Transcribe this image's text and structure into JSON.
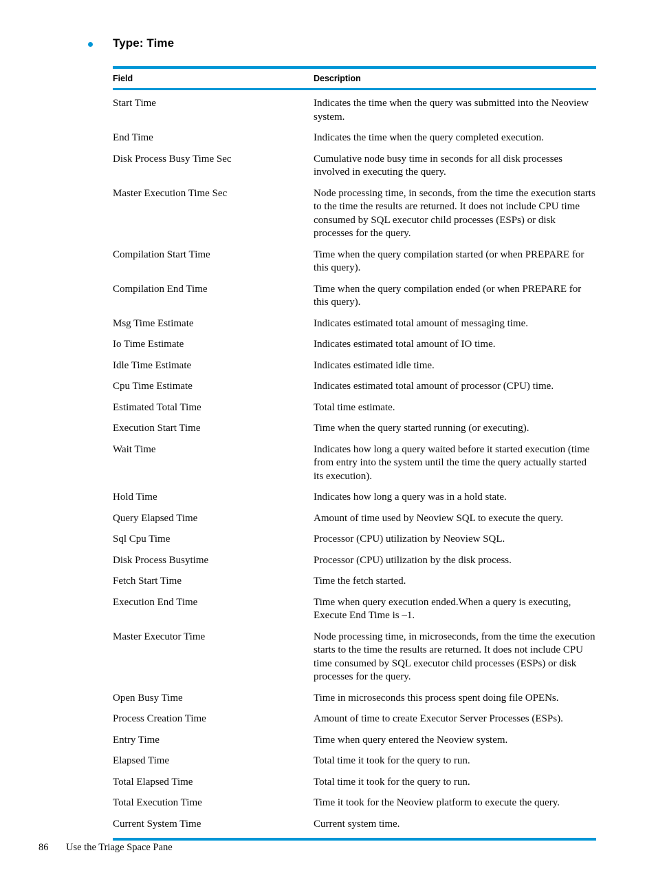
{
  "heading": {
    "bullet_color": "#0096d6",
    "text": "Type: Time"
  },
  "table": {
    "rule_color": "#0096d6",
    "columns": [
      "Field",
      "Description"
    ],
    "rows": [
      {
        "field": "Start Time",
        "description": "Indicates the time when the query was submitted into the Neoview system."
      },
      {
        "field": "End Time",
        "description": "Indicates the time when the query completed execution."
      },
      {
        "field": "Disk Process Busy Time Sec",
        "description": "Cumulative node busy time in seconds for all disk processes involved in executing the query."
      },
      {
        "field": "Master Execution Time Sec",
        "description": "Node processing time, in seconds, from the time the execution starts to the time the results are returned. It does not include CPU time consumed by SQL executor child processes (ESPs) or disk processes for the query."
      },
      {
        "field": "Compilation Start Time",
        "description": "Time when the query compilation started (or when PREPARE for this query)."
      },
      {
        "field": "Compilation End Time",
        "description": "Time when the query compilation ended (or when PREPARE for this query)."
      },
      {
        "field": "Msg Time Estimate",
        "description": "Indicates estimated total amount of messaging time."
      },
      {
        "field": "Io Time Estimate",
        "description": "Indicates estimated total amount of IO time."
      },
      {
        "field": "Idle Time Estimate",
        "description": "Indicates estimated idle time."
      },
      {
        "field": "Cpu Time Estimate",
        "description": "Indicates estimated total amount of processor (CPU) time."
      },
      {
        "field": "Estimated Total Time",
        "description": "Total time estimate."
      },
      {
        "field": "Execution Start Time",
        "description": "Time when the query started running (or executing)."
      },
      {
        "field": "Wait Time",
        "description": "Indicates how long a query waited before it started execution (time from entry into the system until the time the query actually started its execution)."
      },
      {
        "field": "Hold Time",
        "description": "Indicates how long a query was in a hold state."
      },
      {
        "field": "Query Elapsed Time",
        "description": "Amount of time used by Neoview SQL to execute the query."
      },
      {
        "field": "Sql Cpu Time",
        "description": "Processor (CPU) utilization by Neoview SQL."
      },
      {
        "field": "Disk Process Busytime",
        "description": "Processor (CPU) utilization by the disk process."
      },
      {
        "field": "Fetch Start Time",
        "description": "Time the fetch started."
      },
      {
        "field": "Execution End Time",
        "description": "Time when query execution ended.When a query is executing, Execute End Time is –1."
      },
      {
        "field": "Master Executor Time",
        "description": "Node processing time, in microseconds, from the time the execution starts to the time the results are returned. It does not include CPU time consumed by SQL executor child processes (ESPs) or disk processes for the query."
      },
      {
        "field": "Open Busy Time",
        "description": "Time in microseconds this process spent doing file OPENs."
      },
      {
        "field": "Process Creation Time",
        "description": "Amount of time to create Executor Server Processes (ESPs)."
      },
      {
        "field": "Entry Time",
        "description": "Time when query entered the Neoview system."
      },
      {
        "field": "Elapsed Time",
        "description": "Total time it took for the query to run."
      },
      {
        "field": "Total Elapsed Time",
        "description": "Total time it took for the query to run."
      },
      {
        "field": "Total Execution Time",
        "description": "Time it took for the Neoview platform to execute the query."
      },
      {
        "field": "Current System Time",
        "description": "Current system time."
      }
    ]
  },
  "footer": {
    "page_number": "86",
    "title": "Use the Triage Space Pane"
  }
}
